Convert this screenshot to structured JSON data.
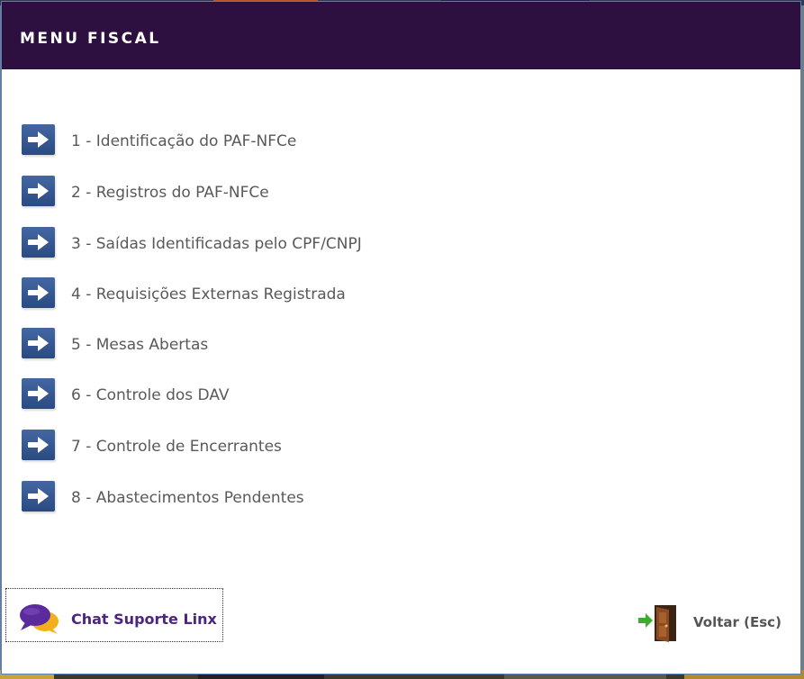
{
  "window": {
    "title": "MENU FISCAL"
  },
  "menu": {
    "items": [
      {
        "label": "1 - Identificação do PAF-NFCe"
      },
      {
        "label": "2 - Registros do PAF-NFCe"
      },
      {
        "label": "3 - Saídas Identificadas pelo CPF/CNPJ"
      },
      {
        "label": "4 - Requisições Externas Registrada"
      },
      {
        "label": "5 - Mesas Abertas"
      },
      {
        "label": "6 - Controle dos DAV"
      },
      {
        "label": "7 - Controle de Encerrantes"
      },
      {
        "label": "8 - Abastecimentos Pendentes"
      }
    ]
  },
  "footer": {
    "chat_label": "Chat Suporte Linx",
    "back_label": "Voltar (Esc)"
  },
  "icons": {
    "menu_item": "arrow-right-icon",
    "chat": "chat-bubbles-icon",
    "back": "door-exit-icon"
  },
  "colors": {
    "titlebar": "#2e1040",
    "arrow_icon": "#2a4a82",
    "chat_text": "#4b2580"
  }
}
